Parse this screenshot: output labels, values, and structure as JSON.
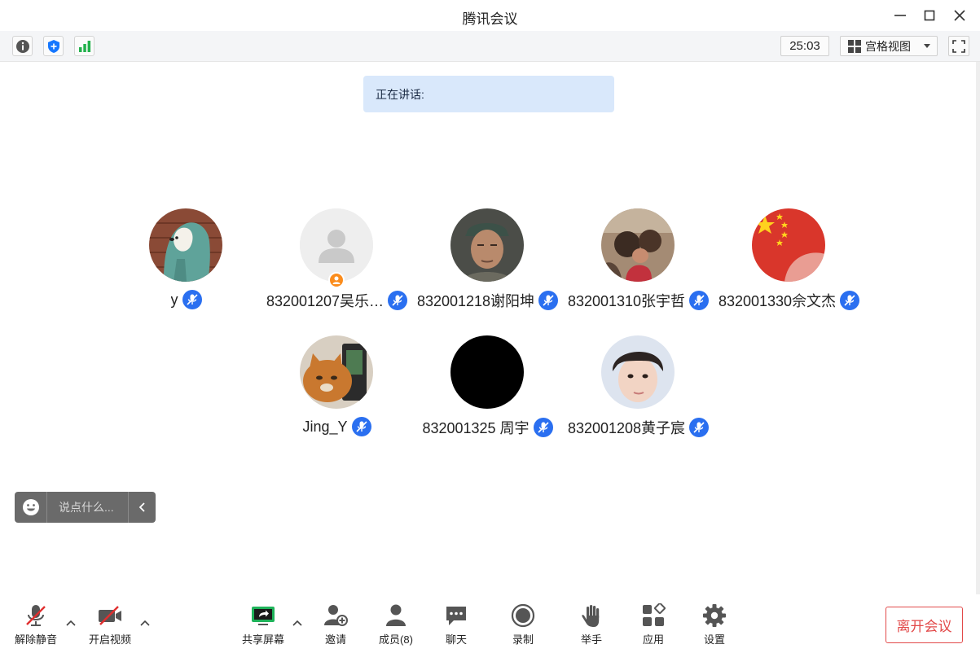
{
  "window": {
    "title": "腾讯会议"
  },
  "toolbar": {
    "timer": "25:03",
    "view_label": "宫格视图"
  },
  "speaking": {
    "label": "正在讲话:"
  },
  "participants": [
    {
      "name": "y",
      "avatar": "bear-hoodie"
    },
    {
      "name": "832001207吴乐…",
      "avatar": "default-person",
      "host": true
    },
    {
      "name": "832001218谢阳坤",
      "avatar": "man-cap"
    },
    {
      "name": "832001310张宇哲",
      "avatar": "family-photo"
    },
    {
      "name": "832001330佘文杰",
      "avatar": "china-flag"
    },
    {
      "name": "Jing_Y",
      "avatar": "cat"
    },
    {
      "name": "832001325 周宇",
      "avatar": "black"
    },
    {
      "name": "832001208黄子宸",
      "avatar": "boy-portrait"
    }
  ],
  "chat": {
    "placeholder": "说点什么..."
  },
  "bottom": {
    "unmute": "解除静音",
    "start_video": "开启视频",
    "share_screen": "共享屏幕",
    "invite": "邀请",
    "members": "成员(8)",
    "chat": "聊天",
    "record": "录制",
    "raise_hand": "举手",
    "apps": "应用",
    "settings": "设置",
    "leave": "离开会议"
  },
  "colors": {
    "accent_blue": "#2a6ff0",
    "leave_red": "#e24a4a",
    "speaking_bg": "#d9e8fb",
    "shield_blue": "#1677ff",
    "signal_green": "#22b14c",
    "share_green": "#1fb35a"
  }
}
